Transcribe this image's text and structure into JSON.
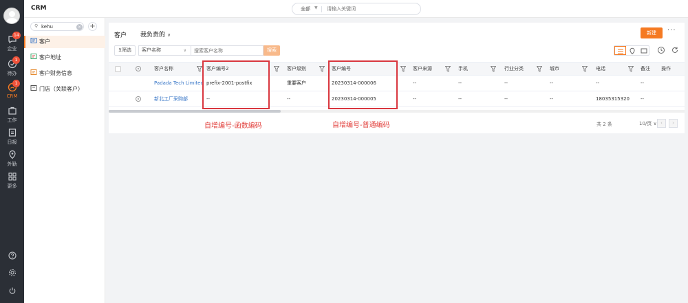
{
  "app": {
    "title": "CRM"
  },
  "global_search": {
    "scope": "全部",
    "placeholder": "请输入关键词"
  },
  "rail": {
    "items": [
      {
        "name": "message",
        "label": "企业",
        "badge": "14"
      },
      {
        "name": "todo",
        "label": "待办",
        "badge": "1"
      },
      {
        "name": "crm",
        "label": "CRM",
        "badge": "1",
        "active": true
      },
      {
        "name": "work",
        "label": "工作",
        "badge": ""
      },
      {
        "name": "log",
        "label": "日报",
        "badge": ""
      },
      {
        "name": "checkin",
        "label": "外勤",
        "badge": ""
      },
      {
        "name": "more",
        "label": "更多",
        "badge": ""
      }
    ],
    "accent": "#f57a22",
    "background": "#2b2f36"
  },
  "menu": {
    "search_value": "kehu",
    "items": [
      {
        "label": "客户",
        "active": true
      },
      {
        "label": "客户地址"
      },
      {
        "label": "客户财务信息"
      },
      {
        "label": "门店（关联客户）"
      }
    ]
  },
  "header": {
    "title": "客户",
    "view": "我负责的",
    "new_label": "新建",
    "more_label": "···"
  },
  "filter_bar": {
    "filter_label": "筛选",
    "field": "客户名称",
    "input_placeholder": "搜索客户名称",
    "search_label": "搜索"
  },
  "table": {
    "columns": [
      "客户名称",
      "客户编号2",
      "客户级别",
      "客户编号",
      "客户来源",
      "手机",
      "行业分类",
      "城市",
      "电话",
      "备注",
      "操作"
    ],
    "rows": [
      {
        "name": "Padada Tech Limited",
        "code2": "prefix-2001-postfix",
        "level": "重要客户",
        "code": "20230314-000006",
        "source": "--",
        "mobile": "--",
        "industry": "--",
        "city": "--",
        "phone": "--",
        "remark": "--"
      },
      {
        "name": "新北工厂采购部",
        "code2": "--",
        "level": "--",
        "code": "20230314-000005",
        "source": "--",
        "mobile": "--",
        "industry": "--",
        "city": "--",
        "phone": "18035315320",
        "remark": "--"
      }
    ]
  },
  "annotations": {
    "left_label": "自增编号-函数编码",
    "right_label": "自增编号-普通编码",
    "color": "#d9363e"
  },
  "pager": {
    "total": "共 2 条",
    "page_size": "10/页"
  }
}
